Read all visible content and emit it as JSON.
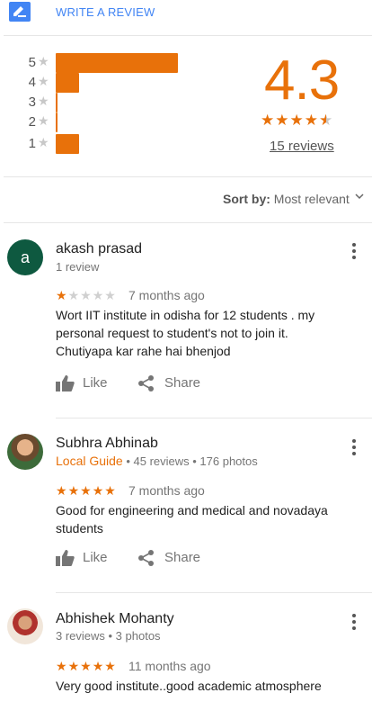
{
  "header": {
    "write_review_label": "WRITE A REVIEW",
    "write_icon": "edit-pencil-icon",
    "accent_color": "#4285f4"
  },
  "summary": {
    "rating": "4.3",
    "rating_value": 4.3,
    "review_count_label": "15 reviews",
    "bar_color": "#e8710a",
    "distribution": [
      {
        "stars": "5",
        "fraction": 1.0
      },
      {
        "stars": "4",
        "fraction": 0.19
      },
      {
        "stars": "3",
        "fraction": 0.0
      },
      {
        "stars": "2",
        "fraction": 0.0
      },
      {
        "stars": "1",
        "fraction": 0.19
      }
    ]
  },
  "sort": {
    "label": "Sort by:",
    "value": "Most relevant"
  },
  "reviews": [
    {
      "name": "akash prasad",
      "avatar_letter": "a",
      "meta": "1 review",
      "local_guide": "",
      "rating": 1,
      "time": "7 months ago",
      "text": "Wort IIT institute in odisha for 12 students . my personal request to student's not to join it. Chutiyapa kar rahe hai bhenjod",
      "like_label": "Like",
      "share_label": "Share"
    },
    {
      "name": "Subhra Abhinab",
      "avatar_letter": "",
      "meta": " • 45 reviews • 176 photos",
      "local_guide": "Local Guide",
      "rating": 5,
      "time": "7 months ago",
      "text": "Good for engineering and medical and novadaya students",
      "like_label": "Like",
      "share_label": "Share"
    },
    {
      "name": "Abhishek Mohanty",
      "avatar_letter": "",
      "meta": "3 reviews • 3 photos",
      "local_guide": "",
      "rating": 5,
      "time": "11 months ago",
      "text": "Very good institute..good academic atmosphere",
      "like_label": "Like",
      "share_label": "Share"
    }
  ]
}
